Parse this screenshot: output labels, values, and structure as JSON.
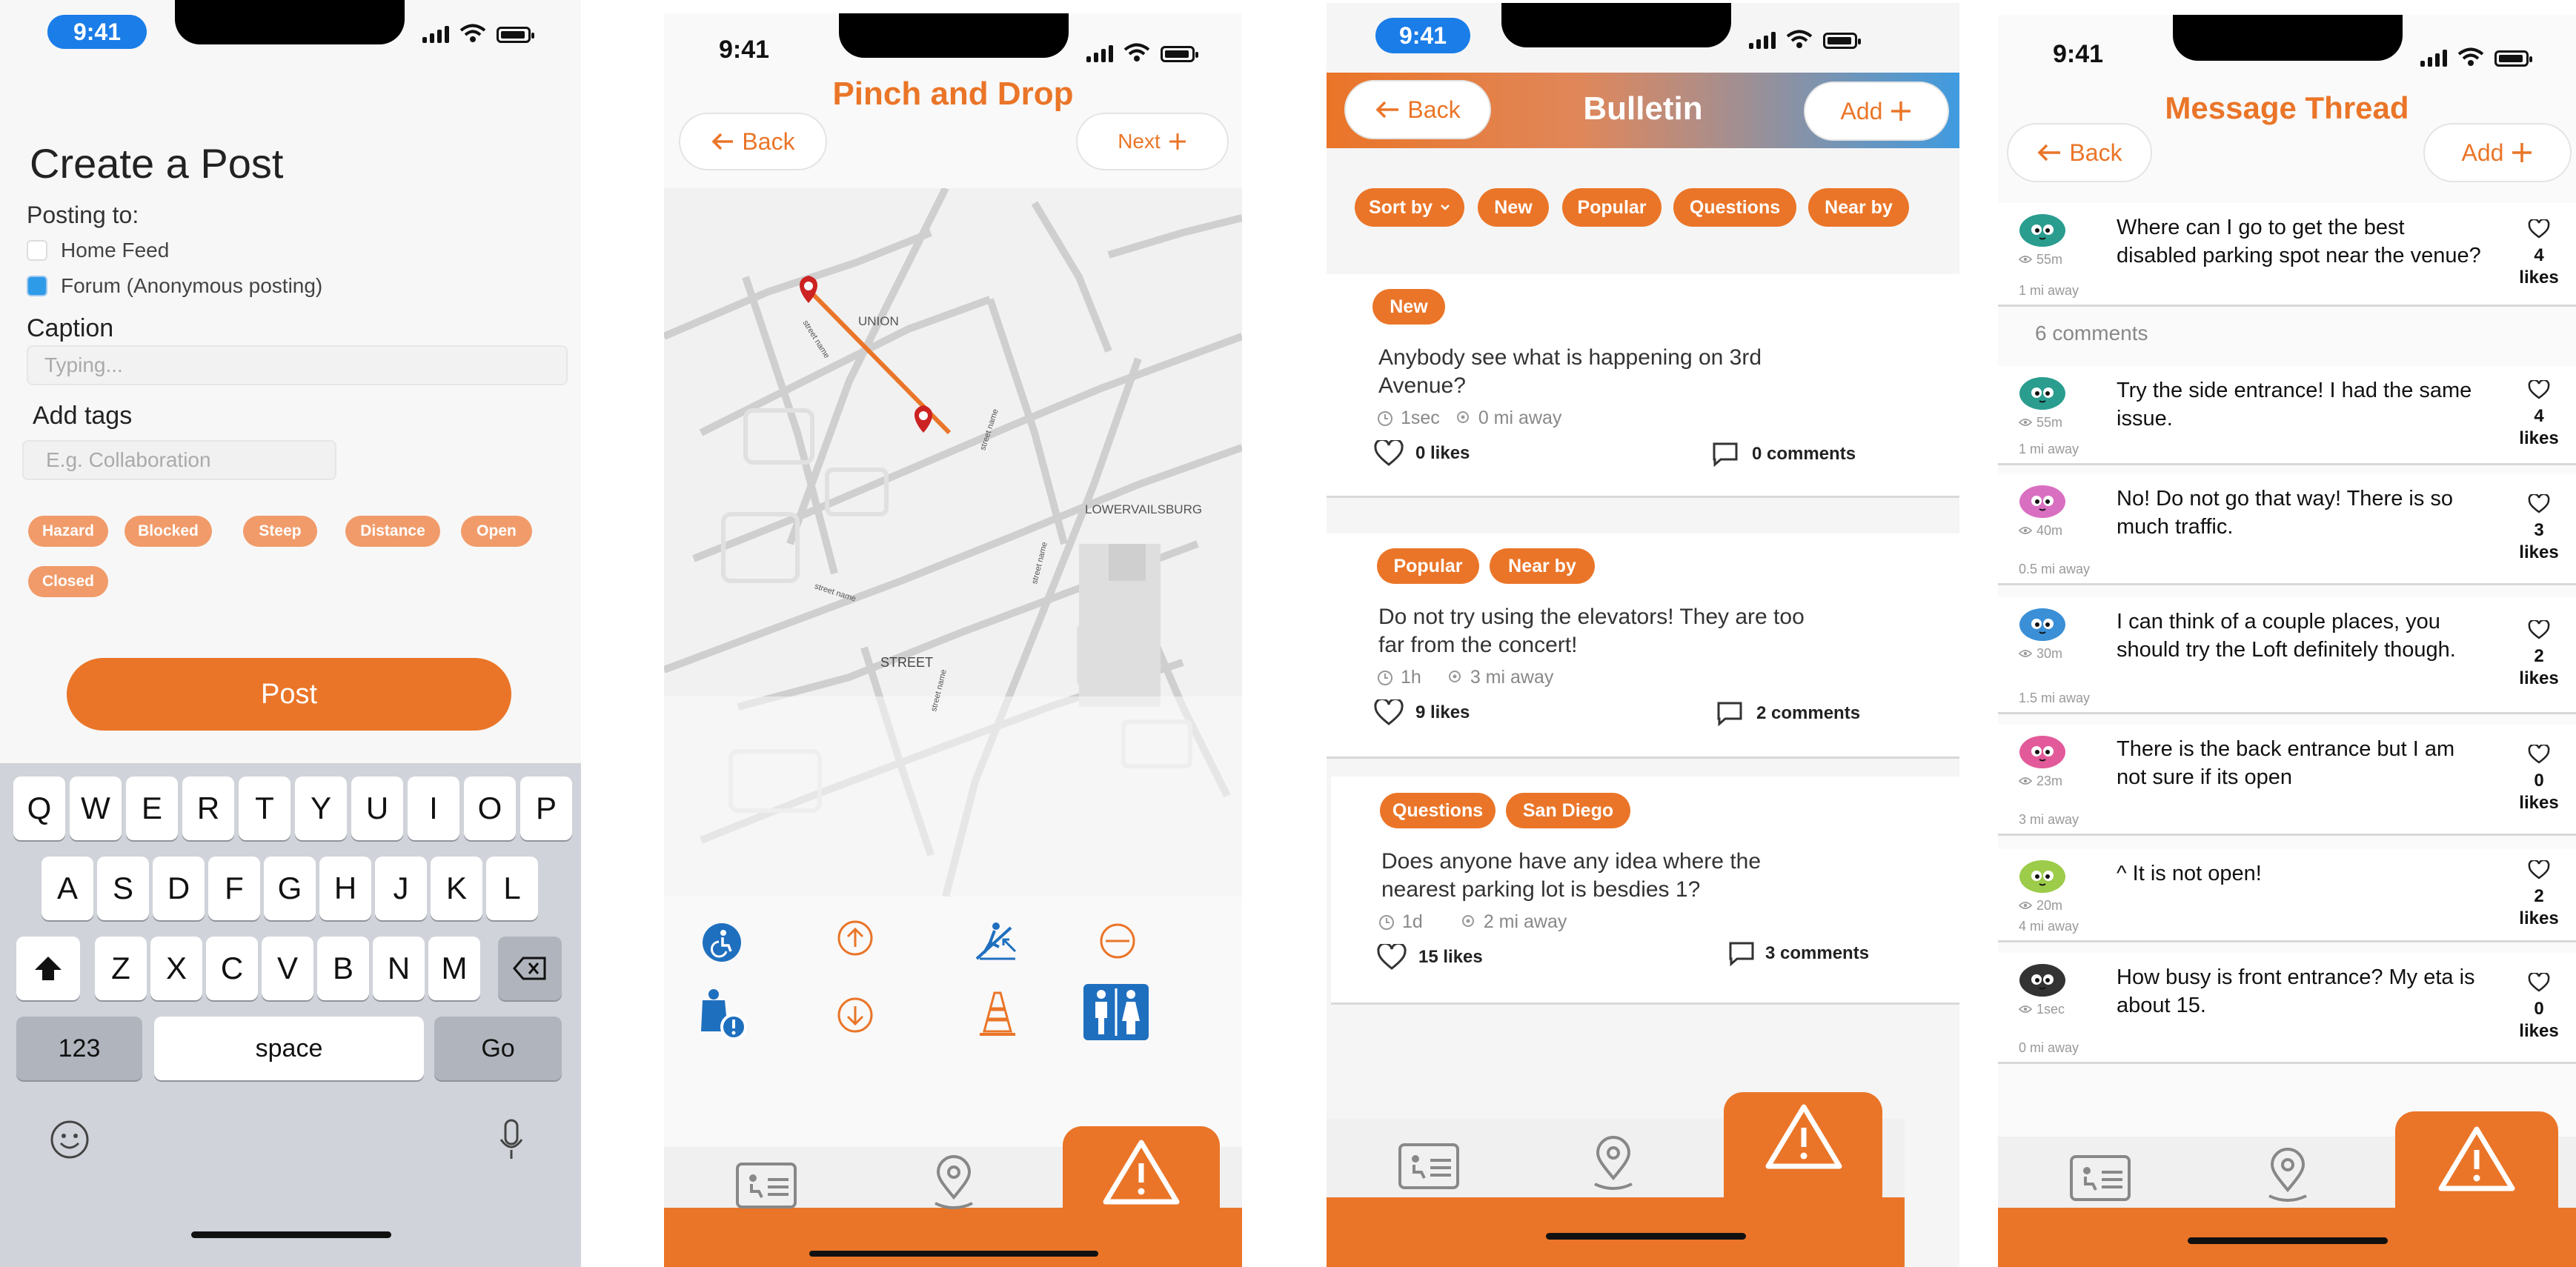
{
  "theme": {
    "accent": "#ea7528",
    "blue": "#1f6fbf"
  },
  "screen1": {
    "time": "9:41",
    "title": "Create a Post",
    "posting_to_label": "Posting to:",
    "options": [
      {
        "label": "Home Feed",
        "checked": false
      },
      {
        "label": "Forum (Anonymous posting)",
        "checked": true
      }
    ],
    "caption_label": "Caption",
    "caption_placeholder": "Typing...",
    "tags_label": "Add tags",
    "tags_placeholder": "E.g. Collaboration",
    "tags": [
      "Hazard",
      "Blocked",
      "Steep",
      "Distance",
      "Open",
      "Closed"
    ],
    "post_button": "Post",
    "keyboard": {
      "row1": [
        "Q",
        "W",
        "E",
        "R",
        "T",
        "Y",
        "U",
        "I",
        "O",
        "P"
      ],
      "row2": [
        "A",
        "S",
        "D",
        "F",
        "G",
        "H",
        "J",
        "K",
        "L"
      ],
      "row3": [
        "Z",
        "X",
        "C",
        "V",
        "B",
        "N",
        "M"
      ],
      "numbers": "123",
      "space": "space",
      "go": "Go"
    }
  },
  "screen2": {
    "time": "9:41",
    "title": "Pinch and Drop",
    "back": "Back",
    "next": "Next",
    "map_labels": [
      "UNION",
      "LOWERVAILSBURG",
      "STREET",
      "street name",
      "street name",
      "street name",
      "street name",
      "street name"
    ],
    "icons": [
      "wheelchair-icon",
      "arrow-up-icon",
      "steep-slope-icon",
      "no-entry-icon",
      "accessibility-alert-icon",
      "arrow-down-icon",
      "traffic-cone-icon",
      "restroom-icon"
    ]
  },
  "screen3": {
    "time": "9:41",
    "title": "Bulletin",
    "back": "Back",
    "add": "Add",
    "filters": [
      "Sort by",
      "New",
      "Popular",
      "Questions",
      "Near by"
    ],
    "posts": [
      {
        "tags": [
          "New"
        ],
        "text": "Anybody see what is happening on 3rd Avenue?",
        "time": "1sec",
        "distance": "0 mi away",
        "likes": "0 likes",
        "comments": "0 comments"
      },
      {
        "tags": [
          "Popular",
          "Near by"
        ],
        "text": "Do not try using the elevators! They are too far from the concert!",
        "time": "1h",
        "distance": "3 mi away",
        "likes": "9 likes",
        "comments": "2 comments"
      },
      {
        "tags": [
          "Questions",
          "San Diego"
        ],
        "text": "Does anyone have any idea where the nearest parking lot is besdies 1?",
        "time": "1d",
        "distance": "2 mi away",
        "likes": "15 likes",
        "comments": "3 comments"
      }
    ]
  },
  "screen4": {
    "time": "9:41",
    "title": "Message Thread",
    "back": "Back",
    "add": "Add",
    "original": {
      "text": "Where can I go to get the best disabled parking spot near the venue?",
      "views": "55m",
      "distance": "1 mi away",
      "likes_count": "4",
      "likes_label": "likes",
      "avatar_color": "#2a9d8f"
    },
    "comments_header": "6 comments",
    "replies": [
      {
        "text": "Try the side entrance! I had the same issue.",
        "views": "55m",
        "distance": "1 mi away",
        "likes_count": "4",
        "likes_label": "likes",
        "avatar_color": "#2a9d8f"
      },
      {
        "text": "No! Do not go that way! There is so much traffic.",
        "views": "40m",
        "distance": "0.5 mi away",
        "likes_count": "3",
        "likes_label": "likes",
        "avatar_color": "#d96fc1"
      },
      {
        "text": "I can think of a couple places, you should try the Loft definitely though.",
        "views": "30m",
        "distance": "1.5 mi away",
        "likes_count": "2",
        "likes_label": "likes",
        "avatar_color": "#3a8fd6"
      },
      {
        "text": "There is the back entrance but I am not sure if its open",
        "views": "23m",
        "distance": "3 mi away",
        "likes_count": "0",
        "likes_label": "likes",
        "avatar_color": "#e25a9a"
      },
      {
        "text": "^ It is not open!",
        "views": "20m",
        "distance": "4 mi away",
        "likes_count": "2",
        "likes_label": "likes",
        "avatar_color": "#9ccc4a"
      },
      {
        "text": "How busy is front entrance? My eta is about 15.",
        "views": "1sec",
        "distance": "0 mi away",
        "likes_count": "0",
        "likes_label": "likes",
        "avatar_color": "#333333"
      }
    ]
  }
}
